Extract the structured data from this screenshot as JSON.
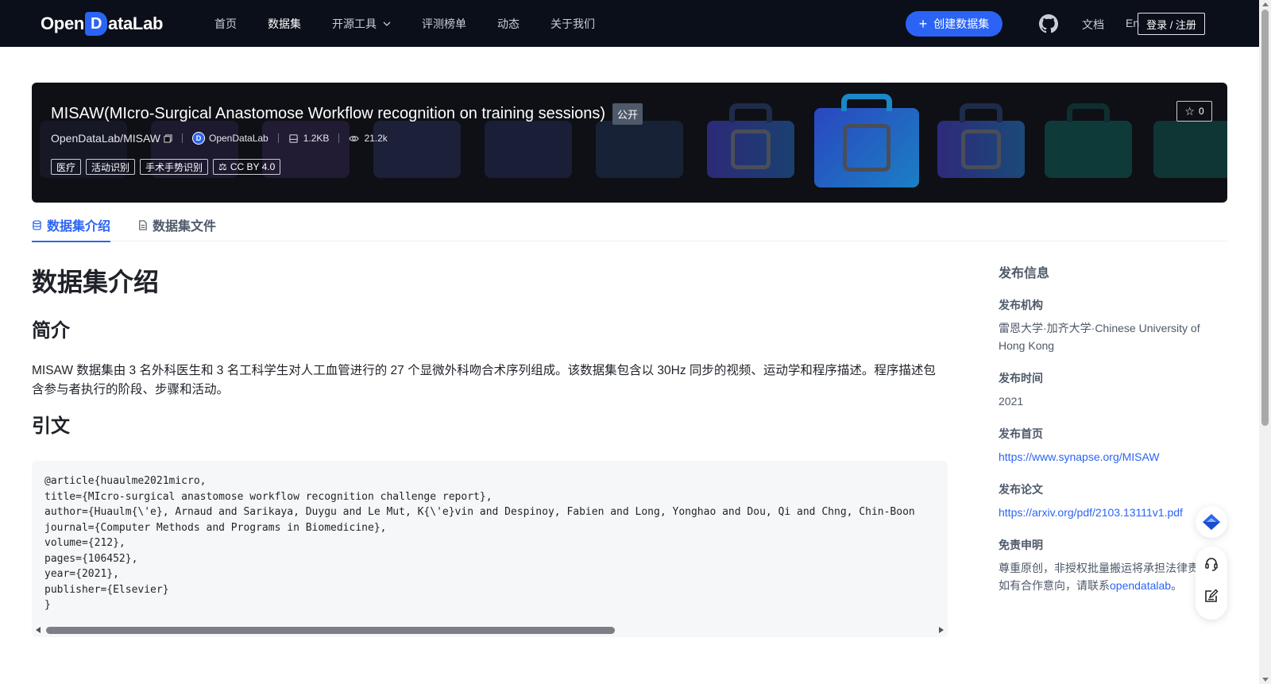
{
  "colors": {
    "nav_bg": "#0b0f1a",
    "accent": "#2b64f5",
    "hero_bg": "#0e1015",
    "code_bg": "#f6f7f9"
  },
  "nav": {
    "logo": {
      "part1": "Open",
      "part2": "D",
      "part3": "ataLab"
    },
    "items": [
      {
        "label": "首页"
      },
      {
        "label": "数据集"
      },
      {
        "label": "开源工具"
      },
      {
        "label": "评测榜单"
      },
      {
        "label": "动态"
      },
      {
        "label": "关于我们"
      }
    ],
    "create_label": "创建数据集",
    "github_icon": "github-icon",
    "docs_label": "文档",
    "lang_label": "En",
    "login_label": "登录 / 注册"
  },
  "hero": {
    "title": "MISAW(MIcro-Surgical Anastomose Workflow recognition on training sessions)",
    "visibility": "公开",
    "star_count": "0",
    "repo": "OpenDataLab/MISAW",
    "org": "OpenDataLab",
    "size": "1.2KB",
    "views": "21.2k",
    "tags": [
      "医疗",
      "活动识别",
      "手术手势识别"
    ],
    "license": "CC BY 4.0"
  },
  "tabs": [
    {
      "label": "数据集介绍"
    },
    {
      "label": "数据集文件"
    }
  ],
  "main": {
    "heading": "数据集介绍",
    "intro_heading": "简介",
    "intro_text": "MISAW 数据集由 3 名外科医生和 3 名工科学生对人工血管进行的 27 个显微外科吻合术序列组成。该数据集包含以 30Hz 同步的视频、运动学和程序描述。程序描述包含参与者执行的阶段、步骤和活动。",
    "citation_heading": "引文",
    "citation_code": "@article{huaulme2021micro,\ntitle={MIcro-surgical anastomose workflow recognition challenge report},\nauthor={Huaulm{\\'e}, Arnaud and Sarikaya, Duygu and Le Mut, K{\\'e}vin and Despinoy, Fabien and Long, Yonghao and Dou, Qi and Chng, Chin-Boon\njournal={Computer Methods and Programs in Biomedicine},\nvolume={212},\npages={106452},\nyear={2021},\npublisher={Elsevier}\n}"
  },
  "sidebar": {
    "title": "发布信息",
    "org_label": "发布机构",
    "org_value": "雷恩大学·加齐大学·Chinese University of Hong Kong",
    "time_label": "发布时间",
    "time_value": "2021",
    "homepage_label": "发布首页",
    "homepage_value": "https://www.synapse.org/MISAW",
    "paper_label": "发布论文",
    "paper_value": "https://arxiv.org/pdf/2103.13111v1.pdf",
    "disclaimer_label": "免责申明",
    "disclaimer_line1": "尊重原创，非授权批量搬运将承担法律责",
    "disclaimer_line2": "如有合作意向，请联系",
    "disclaimer_link": "opendatalab",
    "disclaimer_end": "。"
  }
}
